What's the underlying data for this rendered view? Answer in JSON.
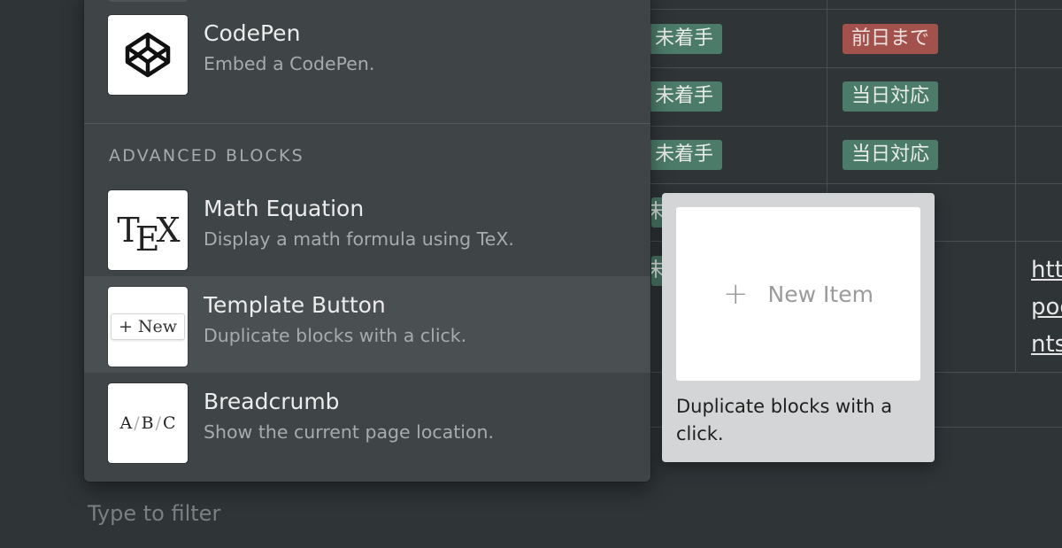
{
  "table": {
    "status_rows": [
      {
        "status": "未着手",
        "due": "前日まで",
        "due_color": "#a3514c"
      },
      {
        "status": "未着手",
        "due": "当日対応",
        "due_color": "#4c7b6a"
      },
      {
        "status": "未着手",
        "due": "当日対応",
        "due_color": "#4c7b6a"
      }
    ],
    "partial_status_fragment": "未",
    "link_fragments": [
      "htt",
      "pod",
      "nts"
    ],
    "tag_green": "#4c7b6a",
    "tag_red": "#a3514c"
  },
  "menu": {
    "codepen": {
      "icon": "codepen-logo-icon",
      "title": "CodePen",
      "desc": "Embed a CodePen."
    },
    "section_header": "ADVANCED BLOCKS",
    "items": [
      {
        "icon": "tex-logo-icon",
        "title": "Math Equation",
        "desc": "Display a math formula using TeX.",
        "thumb_text_t": "T",
        "thumb_text_e": "E",
        "thumb_text_x": "X"
      },
      {
        "icon": "new-button-icon",
        "title": "Template Button",
        "desc": "Duplicate blocks with a click.",
        "thumb_text": "+ New"
      },
      {
        "icon": "breadcrumb-icon",
        "title": "Breadcrumb",
        "desc": "Show the current page location.",
        "thumb_a": "A",
        "thumb_b": "B",
        "thumb_c": "C",
        "thumb_sep": "/"
      }
    ]
  },
  "preview": {
    "button_label": "New Item",
    "plus": "+",
    "caption": "Duplicate blocks with a click."
  },
  "filter": {
    "placeholder": "Type to filter",
    "value": ""
  },
  "colors": {
    "background": "#2f3437",
    "menu_bg": "#3f4447",
    "hover_bg": "#4a4f52",
    "preview_bg": "#d4d5d6"
  }
}
